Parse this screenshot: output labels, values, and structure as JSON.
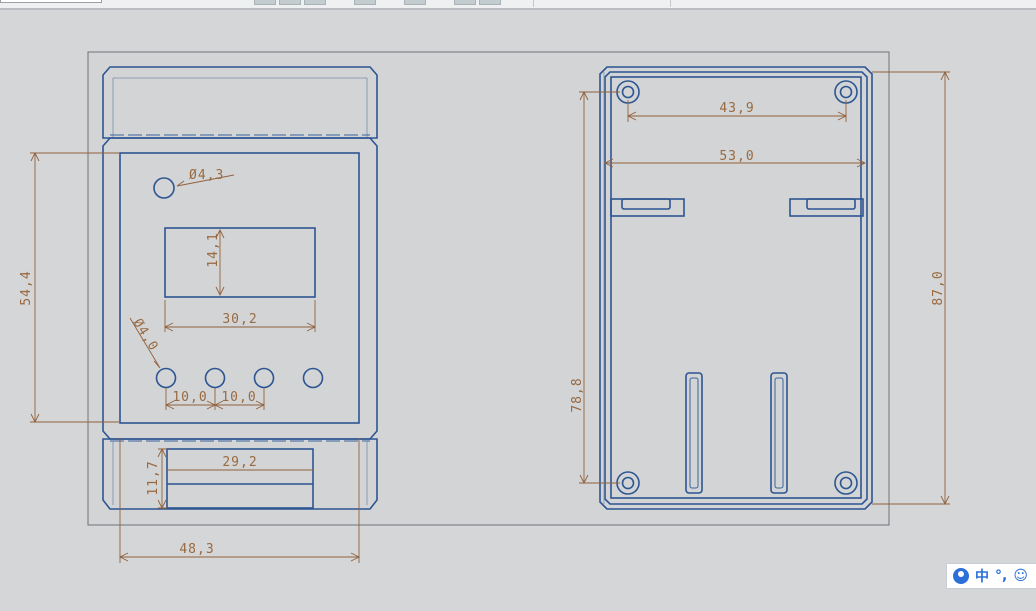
{
  "dimensions": {
    "front_hole_dia": "Ø4,3",
    "front_height": "54,4",
    "window_height": "14,1",
    "window_width": "30,2",
    "button_dia": "Ø4,0",
    "button_pitch_1": "10,0",
    "button_pitch_2": "10,0",
    "terminal_height": "11,7",
    "terminal_width": "29,2",
    "front_width": "48,3",
    "back_hole_pitch_x": "43,9",
    "back_inner_width": "53,0",
    "back_hole_pitch_y": "78,8",
    "back_height": "87,0"
  },
  "ime": {
    "mode": "中",
    "punct": "°,",
    "emoji": "☺"
  },
  "colors": {
    "background": "#d4d6d8",
    "outline": "#2d5592",
    "dimension": "#93613c"
  }
}
